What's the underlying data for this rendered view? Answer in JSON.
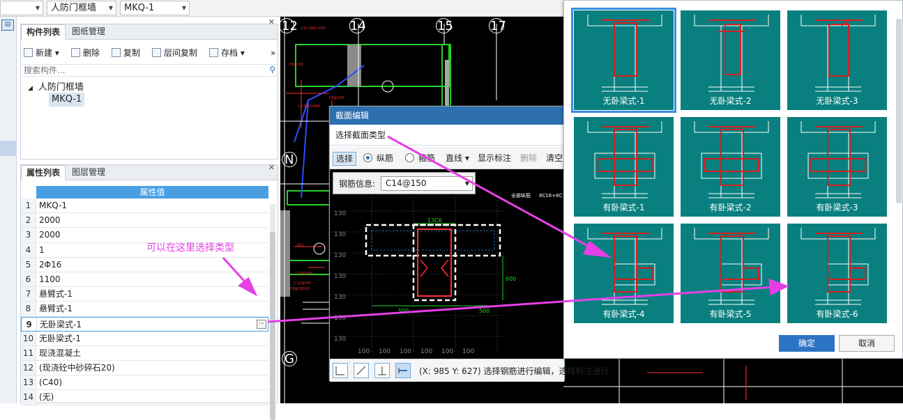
{
  "topbar": {
    "combo1_value": "",
    "combo2_value": "人防门框墙",
    "combo3_value": "MKQ-1"
  },
  "component_panel": {
    "tabs": [
      "构件列表",
      "图纸管理"
    ],
    "toolbar": {
      "new": "新建",
      "delete": "删除",
      "copy": "复制",
      "floor_copy": "层间复制",
      "archive": "存档",
      "more": "»"
    },
    "search_placeholder": "搜索构件...",
    "tree": {
      "parent": "人防门框墙",
      "child": "MKQ-1"
    }
  },
  "property_panel": {
    "tabs": [
      "属性列表",
      "图层管理"
    ],
    "header": "属性值",
    "rows": [
      {
        "num": "1",
        "value": "MKQ-1"
      },
      {
        "num": "2",
        "value": "2000"
      },
      {
        "num": "3",
        "value": "2000"
      },
      {
        "num": "4",
        "value": "1"
      },
      {
        "num": "5",
        "value": "2Φ16"
      },
      {
        "num": "6",
        "value": "1100"
      },
      {
        "num": "7",
        "value": "悬臂式-1"
      },
      {
        "num": "8",
        "value": "悬臂式-1"
      },
      {
        "num": "9",
        "value": "无卧梁式-1"
      },
      {
        "num": "10",
        "value": "无卧梁式-1"
      },
      {
        "num": "11",
        "value": "现浇混凝土"
      },
      {
        "num": "12",
        "value": "(现浇砼中砂碎石20)"
      },
      {
        "num": "13",
        "value": "(C40)"
      },
      {
        "num": "14",
        "value": "(无)"
      }
    ],
    "selected_row": 9,
    "dots_button": "···"
  },
  "cad": {
    "axis_top": [
      "12",
      "14",
      "15",
      "17"
    ],
    "axis_left": [
      "N",
      "G"
    ]
  },
  "section_editor": {
    "title": "截面编辑",
    "subtitle": "选择截面类型",
    "tools": {
      "select": "选择",
      "longitudinal": "纵筋",
      "stirrup": "箍筋",
      "line": "直线",
      "show_labels": "显示标注",
      "delete": "删除",
      "clear": "清空"
    },
    "longitudinal_checked": true,
    "rebar_info_label": "钢筋信息:",
    "rebar_info_value": "C14@150",
    "status_text": "(X: 985 Y: 627) 选择钢筋进行编辑，选择标注进行"
  },
  "type_picker": {
    "items": [
      "无卧梁式-1",
      "无卧梁式-2",
      "无卧梁式-3",
      "有卧梁式-1",
      "有卧梁式-2",
      "有卧梁式-3",
      "有卧梁式-4",
      "有卧梁式-5",
      "有卧梁式-6"
    ],
    "selected_index": 0,
    "confirm": "确定",
    "cancel": "取消"
  },
  "annotation": {
    "text": "可以在这里选择类型",
    "color": "#e63fe6"
  },
  "colors": {
    "cell_bg": "#09807f",
    "rebar_red": "#d61f1f",
    "selection_blue": "#3a8ee6",
    "header_blue": "#4a9fe3",
    "title_blue": "#2e6fb0"
  }
}
